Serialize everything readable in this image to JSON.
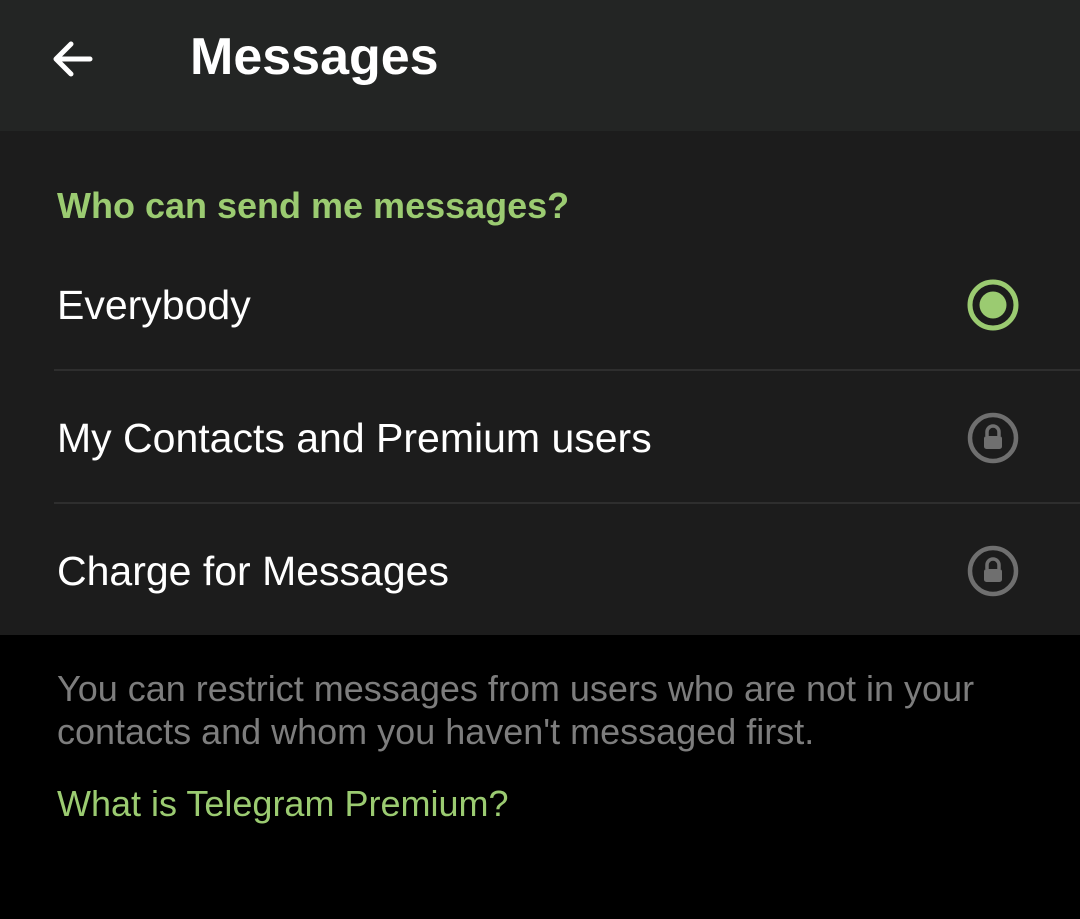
{
  "header": {
    "title": "Messages",
    "back_icon": "arrow-left-icon"
  },
  "section": {
    "title": "Who can send me messages?"
  },
  "options": [
    {
      "label": "Everybody",
      "state": "selected",
      "icon": "radio-selected-icon"
    },
    {
      "label": "My Contacts and Premium users",
      "state": "locked",
      "icon": "lock-icon"
    },
    {
      "label": "Charge for Messages",
      "state": "locked",
      "icon": "lock-icon"
    }
  ],
  "info": {
    "description": "You can restrict messages from users who are not in your contacts and whom you haven't messaged first.",
    "link_label": "What is Telegram Premium?"
  },
  "colors": {
    "accent": "#9bcb71",
    "topbar_bg": "#232524",
    "card_bg": "#1c1c1c",
    "page_bg": "#000000",
    "muted_text": "#7d7d7d",
    "lock_gray": "#6f6f6f"
  }
}
